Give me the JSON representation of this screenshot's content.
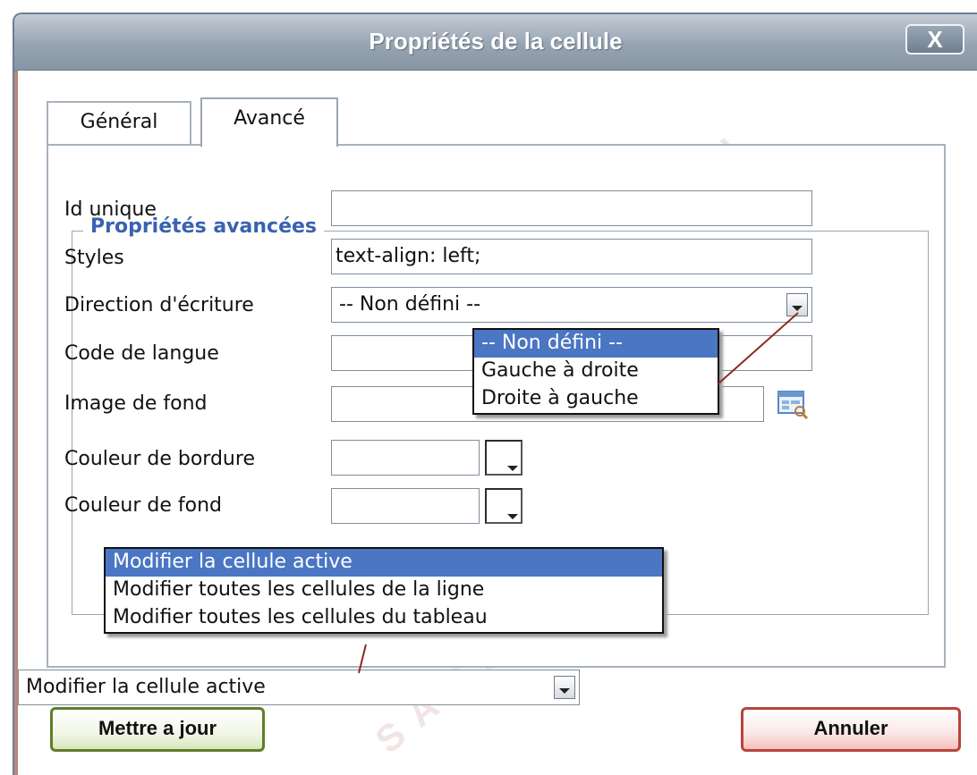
{
  "window": {
    "title": "Propriétés de la cellule",
    "close_label": "X"
  },
  "watermark": "SARKI",
  "tabs": [
    {
      "label": "Général",
      "active": false
    },
    {
      "label": "Avancé",
      "active": true
    }
  ],
  "fieldset": {
    "legend": "Propriétés avancées",
    "fields": {
      "id_label": "Id unique",
      "id_value": "",
      "styles_label": "Styles",
      "styles_value": "text-align: left;",
      "direction_label": "Direction d'écriture",
      "direction_value": "-- Non défini --",
      "lang_label": "Code de langue",
      "lang_value": "",
      "bgimage_label": "Image de fond",
      "bgimage_value": "",
      "border_color_label": "Couleur de bordure",
      "border_color_value": "",
      "bg_color_label": "Couleur de fond",
      "bg_color_value": ""
    }
  },
  "direction_dropdown": {
    "options": [
      "-- Non défini --",
      "Gauche à droite",
      "Droite à gauche"
    ],
    "selected_index": 0
  },
  "scope_dropdown": {
    "options": [
      "Modifier la cellule active",
      "Modifier toutes les cellules de la ligne",
      "Modifier toutes les cellules du tableau"
    ],
    "selected_index": 0
  },
  "scope_select": {
    "value": "Modifier la cellule active"
  },
  "buttons": {
    "update": "Mettre a jour",
    "cancel": "Annuler"
  },
  "colors": {
    "titlebar": "#96a4b2",
    "selection": "#4a76c3",
    "legend": "#3a62b0",
    "update_border": "#5f7d2a",
    "cancel_border": "#b9443c",
    "leader_line": "#8c2a1d"
  }
}
